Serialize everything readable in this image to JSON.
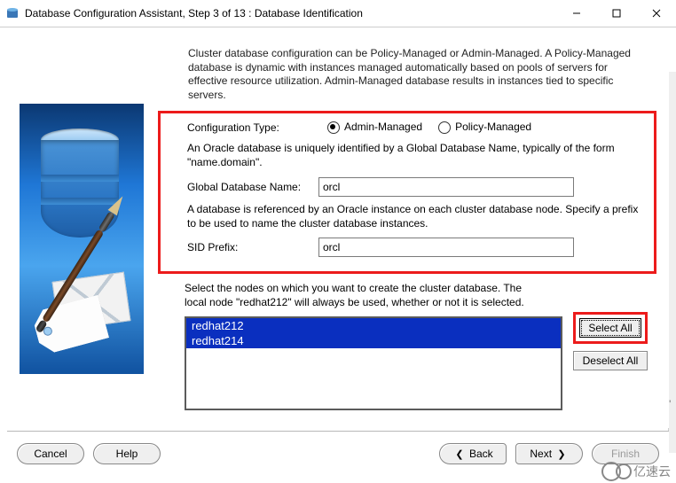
{
  "window": {
    "title": "Database Configuration Assistant, Step 3 of 13 : Database Identification"
  },
  "intro": "Cluster database configuration can be Policy-Managed or Admin-Managed. A Policy-Managed database is dynamic with instances managed automatically based on pools of servers for effective resource utilization. Admin-Managed database results in instances tied to specific servers.",
  "config": {
    "type_label": "Configuration Type:",
    "admin_label": "Admin-Managed",
    "policy_label": "Policy-Managed",
    "selected": "admin",
    "gdb_desc": "An Oracle database is uniquely identified by a Global Database Name, typically of the form \"name.domain\".",
    "gdb_label": "Global Database Name:",
    "gdb_value": "orcl",
    "sid_desc": "A database is referenced by an Oracle instance on each cluster database node. Specify a prefix to be used to name the cluster database instances.",
    "sid_label": "SID Prefix:",
    "sid_value": "orcl"
  },
  "nodes": {
    "desc": "Select the nodes on which you want to create the cluster database. The local node \"redhat212\" will always be used, whether or not it is selected.",
    "items": [
      "redhat212",
      "redhat214"
    ],
    "select_all": "Select All",
    "deselect_all": "Deselect All"
  },
  "nav": {
    "cancel": "Cancel",
    "help": "Help",
    "back": "Back",
    "next": "Next",
    "finish": "Finish"
  },
  "watermark": "亿速云"
}
